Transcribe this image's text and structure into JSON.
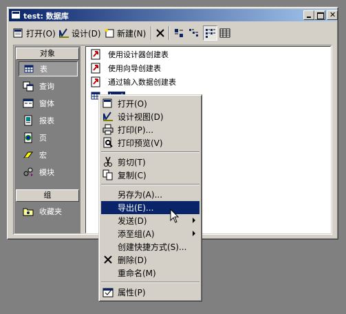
{
  "window": {
    "title": "test: 数据库"
  },
  "toolbar": {
    "open": "打开(O)",
    "design": "设计(D)",
    "new": "新建(N)",
    "delete_icon": "delete-icon",
    "view_icons": [
      "large-icons-icon",
      "small-icons-icon",
      "list-view-icon",
      "details-view-icon"
    ]
  },
  "leftpane": {
    "objects_header": "对象",
    "items": [
      {
        "label": "表",
        "icon": "table-icon",
        "selected": true
      },
      {
        "label": "查询",
        "icon": "query-icon",
        "selected": false
      },
      {
        "label": "窗体",
        "icon": "form-icon",
        "selected": false
      },
      {
        "label": "报表",
        "icon": "report-icon",
        "selected": false
      },
      {
        "label": "页",
        "icon": "page-icon",
        "selected": false
      },
      {
        "label": "宏",
        "icon": "macro-icon",
        "selected": false
      },
      {
        "label": "模块",
        "icon": "module-icon",
        "selected": false
      }
    ],
    "groups_header": "组",
    "favorites": "收藏夹"
  },
  "objects_list": [
    {
      "label": "使用设计器创建表",
      "icon": "shortcut-icon"
    },
    {
      "label": "使用向导创建表",
      "icon": "shortcut-icon"
    },
    {
      "label": "通过输入数据创建表",
      "icon": "shortcut-icon"
    },
    {
      "label": "test",
      "icon": "table-icon",
      "selected": true
    }
  ],
  "context_menu": {
    "items": [
      {
        "label": "打开(O)",
        "icon": "open-icon"
      },
      {
        "label": "设计视图(D)",
        "icon": "design-view-icon"
      },
      {
        "label": "打印(P)...",
        "icon": "print-icon"
      },
      {
        "label": "打印预览(V)",
        "icon": "print-preview-icon"
      },
      {
        "label": "剪切(T)",
        "icon": "cut-icon"
      },
      {
        "label": "复制(C)",
        "icon": "copy-icon"
      },
      {
        "label": "另存为(A)..."
      },
      {
        "label": "导出(E)...",
        "highlighted": true
      },
      {
        "label": "发送(D)",
        "submenu": true
      },
      {
        "label": "添至组(A)",
        "submenu": true
      },
      {
        "label": "创建快捷方式(S)..."
      },
      {
        "label": "删除(D)",
        "icon": "delete-icon"
      },
      {
        "label": "重命名(M)"
      },
      {
        "label": "属性(P)",
        "icon": "properties-icon"
      }
    ]
  },
  "colors": {
    "highlight": "#0a246a",
    "face": "#d4d0c8",
    "desktop": "#808080"
  }
}
